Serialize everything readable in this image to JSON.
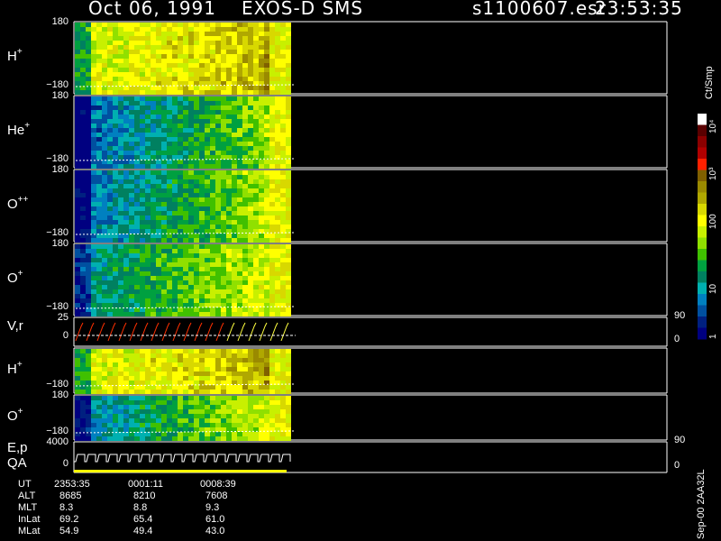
{
  "header": {
    "date": "Oct 06, 1991",
    "instrument": "EXOS-D SMS",
    "file": "s1100607.esr",
    "time": "23:53:35"
  },
  "chart_data": {
    "type": "heatmap",
    "panels": [
      {
        "label": "H",
        "sup": "+",
        "ytop": "180",
        "ybot": "−180",
        "kind": "spec",
        "profile": "h"
      },
      {
        "label": "He",
        "sup": "+",
        "ytop": "180",
        "ybot": "−180",
        "kind": "spec",
        "profile": "he"
      },
      {
        "label": "O",
        "sup": "++",
        "ytop": "180",
        "ybot": "−180",
        "kind": "spec",
        "profile": "opp"
      },
      {
        "label": "O",
        "sup": "+",
        "ytop": "180",
        "ybot": "−180",
        "kind": "spec",
        "profile": "op"
      },
      {
        "label": "V,r",
        "sup": "",
        "ytop": "25",
        "ybot": "0",
        "kind": "line",
        "rtop": "90",
        "rbot": "0"
      },
      {
        "label": "H",
        "sup": "+",
        "ytop": "",
        "ybot": "−180",
        "kind": "spec",
        "profile": "h2"
      },
      {
        "label": "O",
        "sup": "+",
        "ytop": "180",
        "ybot": "−180",
        "kind": "spec",
        "profile": "o2"
      },
      {
        "label": "E,p",
        "label2": "QA",
        "sup": "",
        "ytop": "4000",
        "ybot": "0",
        "kind": "step",
        "rtop": "90",
        "rbot": "0"
      }
    ],
    "colorbar": {
      "unit": "Ct/Smp",
      "ticks": [
        "1",
        "10",
        "100",
        "10³",
        "10⁴"
      ],
      "colors": [
        "#ffffff",
        "#5a0000",
        "#8b0000",
        "#b00000",
        "#ff2000",
        "#806000",
        "#9a8a00",
        "#b0a800",
        "#d8d800",
        "#ffff00",
        "#c8f000",
        "#90e000",
        "#40c000",
        "#00a040",
        "#008060",
        "#00b0b0",
        "#0080c0",
        "#0050a0",
        "#002080",
        "#000080"
      ]
    },
    "footer": {
      "labels": [
        "UT",
        "ALT",
        "MLT",
        "InLat",
        "MLat"
      ],
      "columns": [
        [
          "2353:35",
          "8685",
          "8.3",
          "69.2",
          "54.9"
        ],
        [
          "0001:11",
          "8210",
          "8.8",
          "65.4",
          "49.4"
        ],
        [
          "0008:39",
          "7608",
          "9.3",
          "61.0",
          "43.0"
        ]
      ]
    },
    "side_text": "Sep-00 2AA32L"
  }
}
